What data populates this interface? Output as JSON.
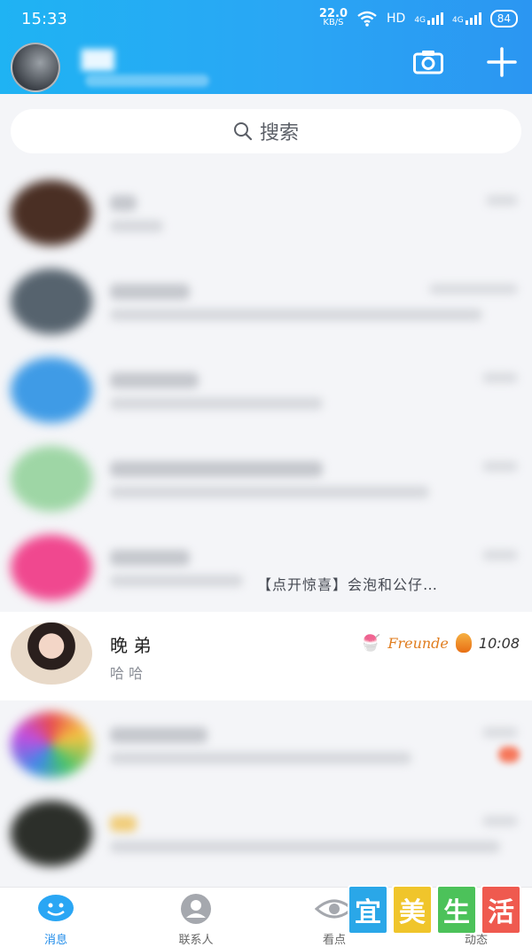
{
  "status_bar": {
    "time": "15:33",
    "speed_value": "22.0",
    "speed_unit": "KB/S",
    "hd": "HD",
    "net1": "4G",
    "net2": "4G",
    "battery": "84"
  },
  "header": {
    "camera_icon": "camera-icon",
    "plus_icon": "plus-icon"
  },
  "search": {
    "placeholder": "搜索"
  },
  "conversations": [
    {
      "blurred": true
    },
    {
      "blurred": true
    },
    {
      "blurred": true
    },
    {
      "blurred": true
    },
    {
      "blurred": true,
      "preview": "【点开惊喜】会泡和公仔…"
    },
    {
      "blurred": false,
      "name": "晚 弟",
      "message": "哈 哈",
      "time": "10:08",
      "tag": "Freunde"
    },
    {
      "blurred": true
    },
    {
      "blurred": true
    }
  ],
  "tabs": [
    {
      "label": "消息",
      "active": true
    },
    {
      "label": "联系人",
      "active": false
    },
    {
      "label": "看点",
      "active": false
    },
    {
      "label": "动态",
      "active": false
    }
  ],
  "watermark": [
    "宜",
    "美",
    "生",
    "活"
  ],
  "colors": {
    "header_start": "#1fb3f3",
    "header_end": "#2b96f2",
    "tab_active": "#1f8be9",
    "watermark": [
      "#2aa7e8",
      "#f0c52b",
      "#4cc25a",
      "#ef5a4f"
    ]
  }
}
